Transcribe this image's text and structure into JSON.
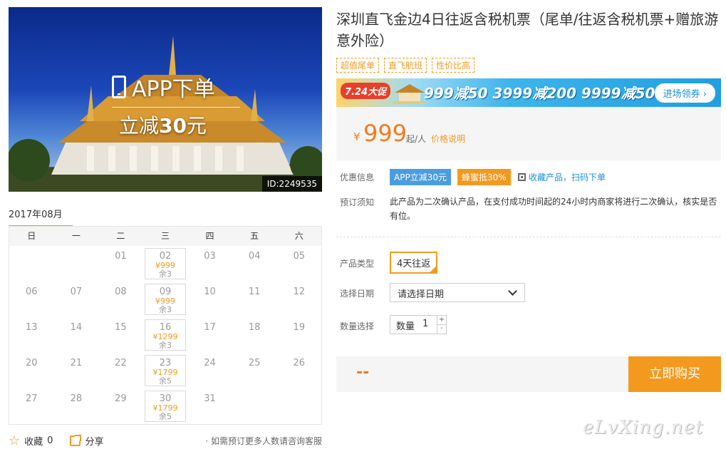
{
  "hero": {
    "promo_line1": "APP下单",
    "promo_line2_prefix": "立减",
    "promo_line2_amount": "30",
    "promo_line2_suffix": "元",
    "id_tag": "ID:2249535"
  },
  "calendar": {
    "month": "2017年08月",
    "weekdays": [
      "日",
      "一",
      "二",
      "三",
      "四",
      "五",
      "六"
    ],
    "days": [
      {
        "d": "",
        "price": "",
        "left": ""
      },
      {
        "d": "",
        "price": "",
        "left": ""
      },
      {
        "d": "01",
        "price": "",
        "left": ""
      },
      {
        "d": "02",
        "price": "¥999",
        "left": "余3"
      },
      {
        "d": "03",
        "price": "",
        "left": ""
      },
      {
        "d": "04",
        "price": "",
        "left": ""
      },
      {
        "d": "05",
        "price": "",
        "left": ""
      },
      {
        "d": "06",
        "price": "",
        "left": ""
      },
      {
        "d": "07",
        "price": "",
        "left": ""
      },
      {
        "d": "08",
        "price": "",
        "left": ""
      },
      {
        "d": "09",
        "price": "¥999",
        "left": "余3"
      },
      {
        "d": "10",
        "price": "",
        "left": ""
      },
      {
        "d": "11",
        "price": "",
        "left": ""
      },
      {
        "d": "12",
        "price": "",
        "left": ""
      },
      {
        "d": "13",
        "price": "",
        "left": ""
      },
      {
        "d": "14",
        "price": "",
        "left": ""
      },
      {
        "d": "15",
        "price": "",
        "left": ""
      },
      {
        "d": "16",
        "price": "¥1299",
        "left": "余3"
      },
      {
        "d": "17",
        "price": "",
        "left": ""
      },
      {
        "d": "18",
        "price": "",
        "left": ""
      },
      {
        "d": "19",
        "price": "",
        "left": ""
      },
      {
        "d": "20",
        "price": "",
        "left": ""
      },
      {
        "d": "21",
        "price": "",
        "left": ""
      },
      {
        "d": "22",
        "price": "",
        "left": ""
      },
      {
        "d": "23",
        "price": "¥1799",
        "left": "余5"
      },
      {
        "d": "24",
        "price": "",
        "left": ""
      },
      {
        "d": "25",
        "price": "",
        "left": ""
      },
      {
        "d": "26",
        "price": "",
        "left": ""
      },
      {
        "d": "27",
        "price": "",
        "left": ""
      },
      {
        "d": "28",
        "price": "",
        "left": ""
      },
      {
        "d": "29",
        "price": "",
        "left": ""
      },
      {
        "d": "30",
        "price": "¥1799",
        "left": "余5"
      },
      {
        "d": "31",
        "price": "",
        "left": ""
      }
    ]
  },
  "footer": {
    "fav_label": "收藏",
    "fav_count": "0",
    "share_label": "分享",
    "note": "· 如需预订更多人数请咨询客服"
  },
  "product": {
    "title": "深圳直飞金边4日往返含税机票（尾单/往返含税机票+赠旅游意外险）",
    "tags": [
      "超值尾单",
      "直飞航班",
      "性价比高"
    ]
  },
  "banner": {
    "badge": "7.24大促",
    "slogan": "999减50 3999减200 9999减500",
    "cta": "进场领券 ›"
  },
  "price": {
    "yen": "¥",
    "amount": "999",
    "unit": "起/人",
    "explain": "价格说明"
  },
  "offers": {
    "label": "优惠信息",
    "app_badge": "APP立减30元",
    "honey_badge": "蜂蜜抵30%",
    "qr_text": "收藏产品，扫码下单"
  },
  "notice": {
    "label": "预订须知",
    "text": "此产品为二次确认产品，在支付成功时间起的24小时内商家将进行二次确认，核实是否有位。"
  },
  "form": {
    "type_label": "产品类型",
    "type_value": "4天往返",
    "date_label": "选择日期",
    "date_placeholder": "请选择日期",
    "qty_label": "数量选择",
    "qty_inner_label": "数量",
    "qty_value": "1",
    "plus": "+",
    "minus": "-"
  },
  "buy": {
    "total": "--",
    "button": "立即购买"
  },
  "watermark": "eLvXing.net",
  "colors": {
    "accent": "#f39a1e",
    "price": "#f37b1d",
    "link": "#1a8fd6",
    "app_badge": "#4a9de0",
    "honey_badge": "#f39a1e"
  }
}
